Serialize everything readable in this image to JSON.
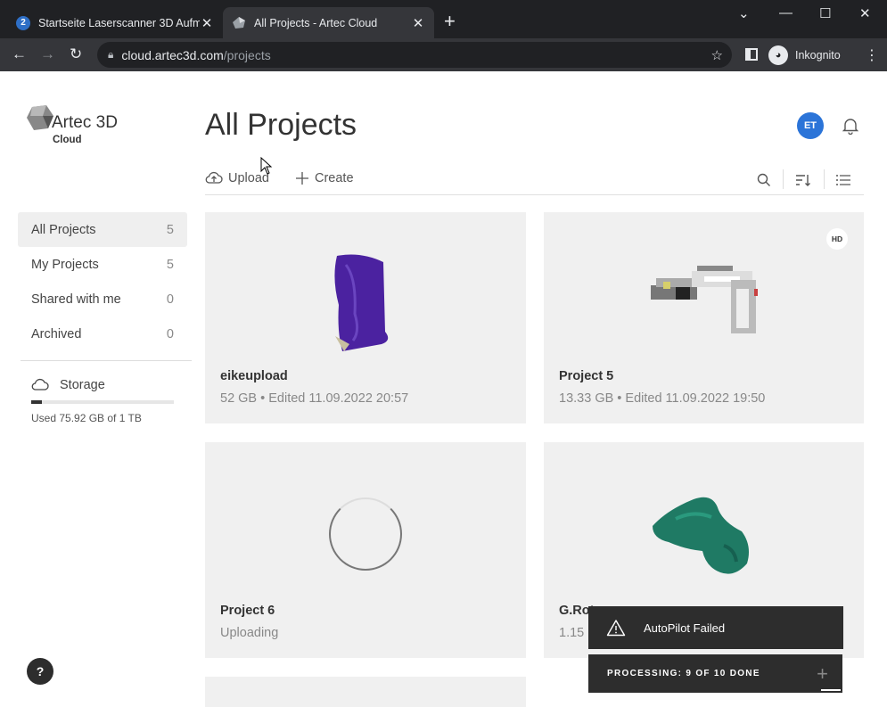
{
  "browser": {
    "tabs": [
      {
        "title": "Startseite Laserscanner 3D Aufma",
        "favicon": "laserscanner-favicon",
        "active": false
      },
      {
        "title": "All Projects - Artec Cloud",
        "favicon": "artec-favicon",
        "active": true
      }
    ],
    "url_host": "cloud.artec3d.com",
    "url_path": "/projects",
    "incognito_label": "Inkognito"
  },
  "logo": {
    "word": "Artec 3D",
    "sub": "Cloud"
  },
  "sidebar": {
    "items": [
      {
        "label": "All Projects",
        "count": "5",
        "active": true
      },
      {
        "label": "My Projects",
        "count": "5",
        "active": false
      },
      {
        "label": "Shared with me",
        "count": "0",
        "active": false
      },
      {
        "label": "Archived",
        "count": "0",
        "active": false
      }
    ],
    "storage": {
      "label": "Storage",
      "used_text": "Used 75.92 GB of 1 TB",
      "fraction": 0.074
    }
  },
  "header": {
    "title": "All Projects",
    "avatar_initials": "ET"
  },
  "actions": {
    "upload": "Upload",
    "create": "Create"
  },
  "projects": [
    {
      "name": "eikeupload",
      "meta": "52 GB • Edited 11.09.2022 20:57",
      "badge": ""
    },
    {
      "name": "Project 5",
      "meta": "13.33 GB • Edited 11.09.2022 19:50",
      "badge": "HD"
    },
    {
      "name": "Project 6",
      "meta": "Uploading",
      "badge": ""
    },
    {
      "name": "G.Rot",
      "meta": "1.15 G",
      "badge": ""
    }
  ],
  "toasts": {
    "autopilot": "AutoPilot Failed",
    "processing": "PROCESSING: 9 OF 10 DONE"
  },
  "help_label": "?",
  "colors": {
    "accent": "#2b74d8",
    "card_bg": "#f0f0f0",
    "toast_bg": "#2d2d2d",
    "model_purple": "#4b22a0",
    "model_teal": "#1f7a64"
  }
}
